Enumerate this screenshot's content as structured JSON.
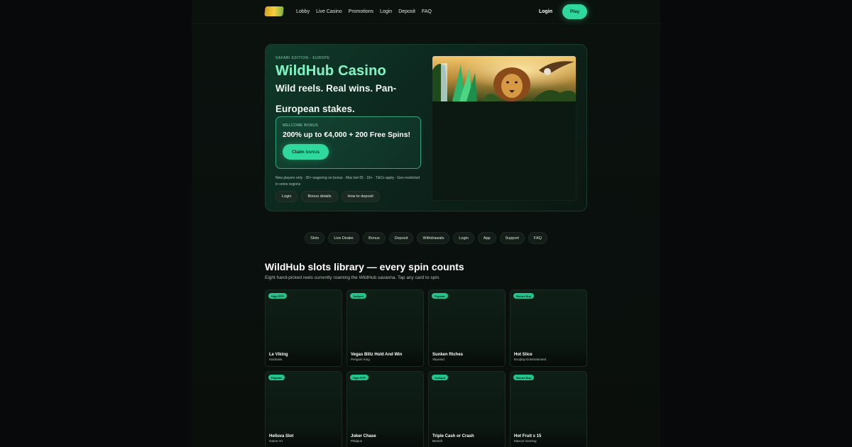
{
  "nav": {
    "links": [
      "Lobby",
      "Live Casino",
      "Promotions",
      "Login",
      "Deposit",
      "FAQ"
    ],
    "login_label": "Login",
    "play_label": "Play"
  },
  "hero": {
    "eyebrow": "SAFARI EDITION - EUROPE",
    "title": "WildHub Casino",
    "tagline": "Wild reels. Real wins. Pan-European stakes.",
    "bonus": {
      "label": "WELCOME BONUS",
      "title": "200% up to €4,000 + 200 Free Spins!",
      "cta": "Claim bonus"
    },
    "disclaimer": "New players only · 35× wagering on bonus · Max bet €5 · 18+ · T&Cs apply · Geo-restricted in some regions",
    "chips": [
      "Login",
      "Bonus details",
      "How to deposit"
    ]
  },
  "categories": [
    "Slots",
    "Live Dealer",
    "Bonus",
    "Deposit",
    "Withdrawals",
    "Login",
    "App",
    "Support",
    "FAQ"
  ],
  "library": {
    "title": "WildHub slots library — every spin counts",
    "subtitle": "Eight hand-picked reels currently roaming the WildHub savanna. Tap any card to spin.",
    "games": [
      {
        "badge": "High RTP",
        "name": "Le Viking",
        "provider": "Hacksaw"
      },
      {
        "badge": "Jackpot",
        "name": "Vegas Blitz Hold And Win",
        "provider": "Penguin King"
      },
      {
        "badge": "Popular",
        "name": "Sunken Riches",
        "provider": "Skywind"
      },
      {
        "badge": "Bonus Buy",
        "name": "Hot Slice",
        "provider": "Evoplay Entertainment"
      },
      {
        "badge": "Popular",
        "name": "Helluva Slot",
        "provider": "Game Art"
      },
      {
        "badge": "High RTP",
        "name": "Joker Chase",
        "provider": "Platipus"
      },
      {
        "badge": "Jackpot",
        "name": "Triple Cash or Crash",
        "provider": "Betsoft"
      },
      {
        "badge": "Bonus Buy",
        "name": "Hot Fruit x 15",
        "provider": "Mascot Gaming"
      }
    ]
  },
  "colors": {
    "accent": "#2fd99e",
    "background": "#07090a",
    "hero_title": "#7ef0c0"
  }
}
